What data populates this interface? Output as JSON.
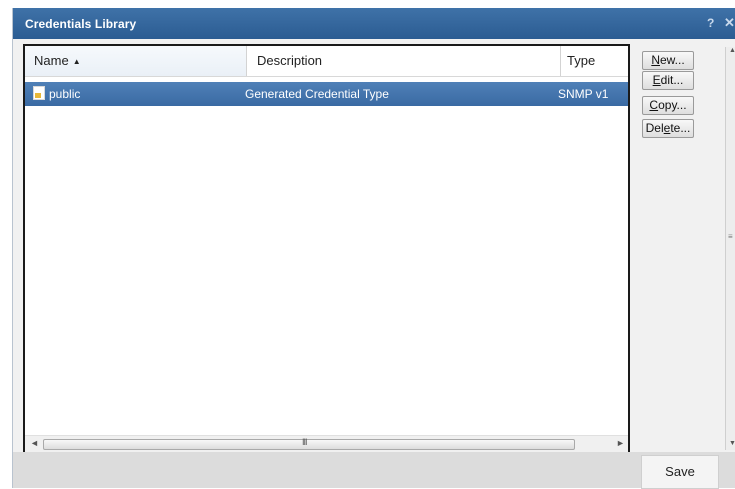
{
  "window": {
    "title": "Credentials Library",
    "help_label": "?",
    "close_label": "✕"
  },
  "table": {
    "columns": [
      {
        "label": "Name",
        "sort": "ascending",
        "sort_glyph": "▲"
      },
      {
        "label": "Description"
      },
      {
        "label": "Type"
      }
    ],
    "rows": [
      {
        "name": "public",
        "description": "Generated Credential Type",
        "type": "SNMP v1",
        "selected": true,
        "icon": "credential-file-icon"
      }
    ]
  },
  "buttons": {
    "new": {
      "accel": "N",
      "rest": "ew..."
    },
    "edit": {
      "accel": "E",
      "rest": "dit..."
    },
    "copy": {
      "accel": "C",
      "rest": "opy..."
    },
    "delete": {
      "before": "Del",
      "accel": "e",
      "after": "te..."
    }
  },
  "scrollbar": {
    "left_arrow": "◄",
    "right_arrow": "►",
    "grip": "III"
  },
  "vscroll": {
    "up_arrow": "▲",
    "down_arrow": "▼",
    "grip": "≡"
  },
  "footer": {
    "save_label": "Save"
  },
  "colors": {
    "titlebar": "#2f6099",
    "selection": "#3f6fa8",
    "dialog_bg": "#dcdcdc"
  }
}
